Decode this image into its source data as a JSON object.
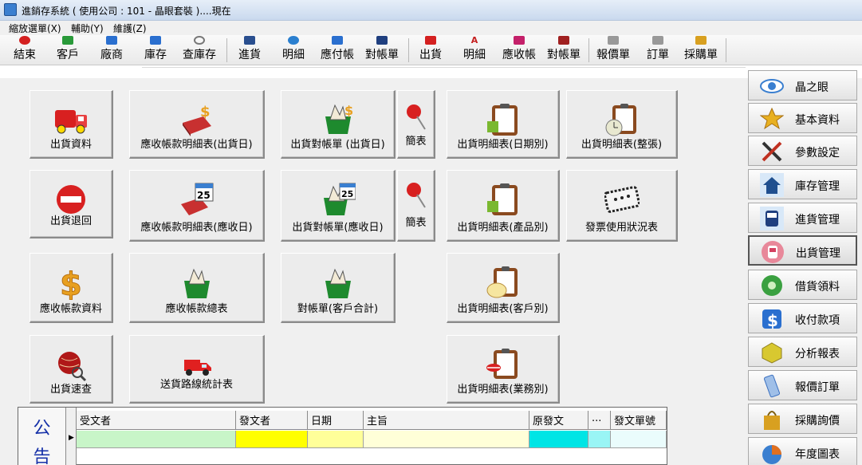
{
  "window": {
    "title": "進銷存系統 ( 使用公司 : 101 - 晶眼套裝 )....現在"
  },
  "menu": [
    {
      "label": "縮放選單(X)"
    },
    {
      "label": "輔助(Y)"
    },
    {
      "label": "維護(Z)"
    }
  ],
  "toolbar": {
    "items": [
      {
        "label": "結束",
        "icon": "exit-icon",
        "color": "#d42020"
      },
      {
        "label": "客戶",
        "icon": "customer-icon",
        "color": "#2a9a3a"
      },
      {
        "label": "廠商",
        "icon": "vendor-icon",
        "color": "#2a6fcf"
      },
      {
        "label": "庫存",
        "icon": "inventory-icon",
        "color": "#2a6fcf"
      },
      {
        "label": "查庫存",
        "icon": "search-inventory-icon",
        "color": "#777777"
      },
      {
        "label": "進貨",
        "icon": "purchase-icon",
        "color": "#2a4f8f"
      },
      {
        "label": "明細",
        "icon": "purchase-detail-icon",
        "color": "#2a7fcf"
      },
      {
        "label": "應付帳",
        "icon": "payable-icon",
        "color": "#2a6fcf"
      },
      {
        "label": "對帳單",
        "icon": "purchase-statement-icon",
        "color": "#1f3f7f"
      },
      {
        "label": "出貨",
        "icon": "shipment-icon",
        "color": "#d42020"
      },
      {
        "label": "明細",
        "icon": "shipment-detail-icon",
        "color": "#c41f1f"
      },
      {
        "label": "應收帳",
        "icon": "receivable-icon",
        "color": "#c4206a"
      },
      {
        "label": "對帳單",
        "icon": "shipment-statement-icon",
        "color": "#a02020"
      },
      {
        "label": "報價單",
        "icon": "quotation-icon",
        "color": "#777777"
      },
      {
        "label": "訂單",
        "icon": "order-icon",
        "color": "#777777"
      },
      {
        "label": "採購單",
        "icon": "purchase-order-icon",
        "color": "#d8a020"
      }
    ]
  },
  "tiles": [
    {
      "label": "出貨資料",
      "icon": "delivery-truck-icon"
    },
    {
      "label": "應收帳款明細表(出貨日)",
      "icon": "ledger-dollar-icon"
    },
    {
      "label": "出貨對帳單 (出貨日)",
      "icon": "basket-dollar-icon"
    },
    {
      "label": "簡表",
      "icon": "pushpin-icon"
    },
    {
      "label": "出貨明細表(日期別)",
      "icon": "clipboard-icon"
    },
    {
      "label": "出貨明細表(整張)",
      "icon": "clipboard-clock-icon"
    },
    {
      "label": "出貨退回",
      "icon": "no-entry-icon"
    },
    {
      "label": "應收帳款明細表(應收日)",
      "icon": "ledger-calendar-icon"
    },
    {
      "label": "出貨對帳單(應收日)",
      "icon": "basket-calendar-icon"
    },
    {
      "label": "簡表",
      "icon": "pushpin-icon"
    },
    {
      "label": "出貨明細表(產品別)",
      "icon": "clipboard-product-icon"
    },
    {
      "label": "發票使用狀況表",
      "icon": "invoice-stamp-icon"
    },
    {
      "label": "應收帳款資料",
      "icon": "dollar-sign-icon"
    },
    {
      "label": "應收帳款總表",
      "icon": "basket-icon"
    },
    {
      "label": "對帳單(客戶合計)",
      "icon": "basket-icon"
    },
    {
      "label": "出貨明細表(客戶別)",
      "icon": "clipboard-customer-icon"
    },
    {
      "label": "出貨速查",
      "icon": "globe-search-icon"
    },
    {
      "label": "送貨路線統計表",
      "icon": "red-truck-icon"
    },
    {
      "label": "出貨明細表(業務別)",
      "icon": "clipboard-lips-icon"
    }
  ],
  "calendar_day": "25",
  "right_menu": {
    "items": [
      {
        "label": "晶之眼",
        "icon": "eye-icon",
        "color": "#3a7fd0"
      },
      {
        "label": "基本資料",
        "icon": "star-icon",
        "color": "#e8b020"
      },
      {
        "label": "參數設定",
        "icon": "tools-icon",
        "color": "#c03020"
      },
      {
        "label": "庫存管理",
        "icon": "house-icon",
        "color": "#2a6fcf"
      },
      {
        "label": "進貨管理",
        "icon": "bus-icon",
        "color": "#1f3f7f"
      },
      {
        "label": "出貨管理",
        "icon": "train-icon",
        "color": "#d44060"
      },
      {
        "label": "借貨領料",
        "icon": "cd-icon",
        "color": "#3aa040"
      },
      {
        "label": "收付款項",
        "icon": "dollar-icon",
        "color": "#2a6fcf"
      },
      {
        "label": "分析報表",
        "icon": "chart-cube-icon",
        "color": "#c0b020"
      },
      {
        "label": "報價訂單",
        "icon": "phone-icon",
        "color": "#3a6fbf"
      },
      {
        "label": "採購詢價",
        "icon": "shopping-bag-icon",
        "color": "#d8a020"
      },
      {
        "label": "年度圖表",
        "icon": "pie-chart-icon",
        "color": "#e07020"
      }
    ],
    "active": "出貨管理"
  },
  "notice": {
    "side_label_1": "公",
    "side_label_2": "告",
    "columns": [
      "受文者",
      "發文者",
      "日期",
      "主旨",
      "原發文",
      "...",
      "發文單號"
    ],
    "row_colors": [
      "#c8f5c8",
      "#ffff00",
      "#ffff99",
      "#ffffd8",
      "#00e5e5",
      "#99f5f5",
      "#eafcfc"
    ]
  }
}
